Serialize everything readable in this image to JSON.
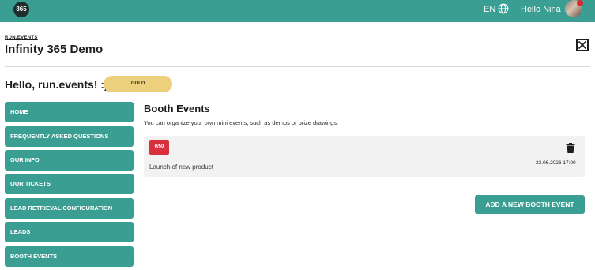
{
  "topbar": {
    "logo_text": "365",
    "language": "EN",
    "greeting": "Hello Nina",
    "icons": {
      "globe": "globe-icon",
      "avatar": "user-avatar"
    },
    "background": "#3a9e93"
  },
  "header": {
    "org_label": "RUN.EVENTS",
    "title": "Infinity 365 Demo"
  },
  "welcome": {
    "greeting": "Hello, run.events! :)",
    "tier_badge": "GOLD",
    "badge_color": "#ecd07b"
  },
  "sidebar": {
    "items": [
      {
        "label": "HOME"
      },
      {
        "label": "FREQUENTLY ASKED QUESTIONS"
      },
      {
        "label": "OUR INFO"
      },
      {
        "label": "OUR TICKETS"
      },
      {
        "label": "LEAD RETRIEVAL CONFIGURATION"
      },
      {
        "label": "LEADS"
      },
      {
        "label": "BOOTH EVENTS"
      }
    ]
  },
  "main": {
    "title": "Booth Events",
    "description": "You can organize your own mini events, such as demos or prize drawings.",
    "events": [
      {
        "count": "0/50",
        "name": "Launch of new product",
        "date": "23.06.2026 17:00"
      }
    ],
    "add_button": "ADD A NEW BOOTH EVENT"
  },
  "colors": {
    "accent": "#3a9e93",
    "count_badge": "#d9303e"
  }
}
